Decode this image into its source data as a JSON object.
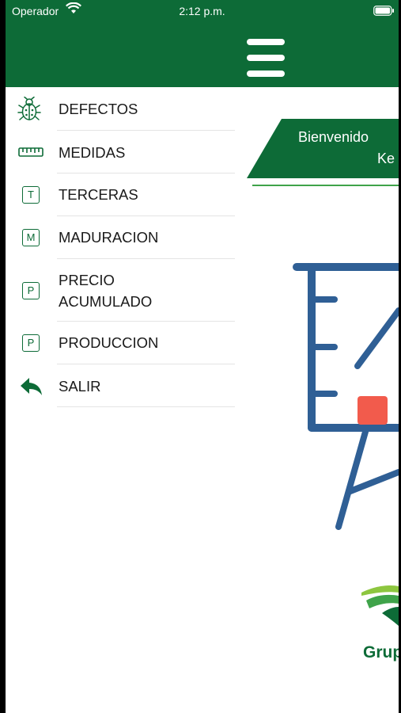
{
  "status_bar": {
    "carrier": "Operador",
    "time": "2:12 p.m."
  },
  "header": {
    "menu_icon": "hamburger-menu-icon",
    "background": "#0d6b37"
  },
  "main": {
    "welcome_text": "Bienvenido",
    "user_name_partial": "Ke",
    "brand_name_partial": "Grup"
  },
  "drawer": {
    "items": [
      {
        "label": "DEFECTOS",
        "icon": "bug-icon"
      },
      {
        "label": "MEDIDAS",
        "icon": "ruler-icon"
      },
      {
        "label": "TERCERAS",
        "icon": "letter-t-icon",
        "letter": "T"
      },
      {
        "label": "MADURACION",
        "icon": "letter-m-icon",
        "letter": "M"
      },
      {
        "label": "PRECIO",
        "label2": "ACUMULADO",
        "icon": "letter-p-icon",
        "letter": "P"
      },
      {
        "label": "PRODUCCION",
        "icon": "letter-p-icon",
        "letter": "P"
      },
      {
        "label": "SALIR",
        "icon": "back-arrow-icon"
      }
    ]
  },
  "colors": {
    "primary": "#0d6b37",
    "accent_red": "#f25b4c",
    "illustration_blue": "#2f5f95"
  }
}
